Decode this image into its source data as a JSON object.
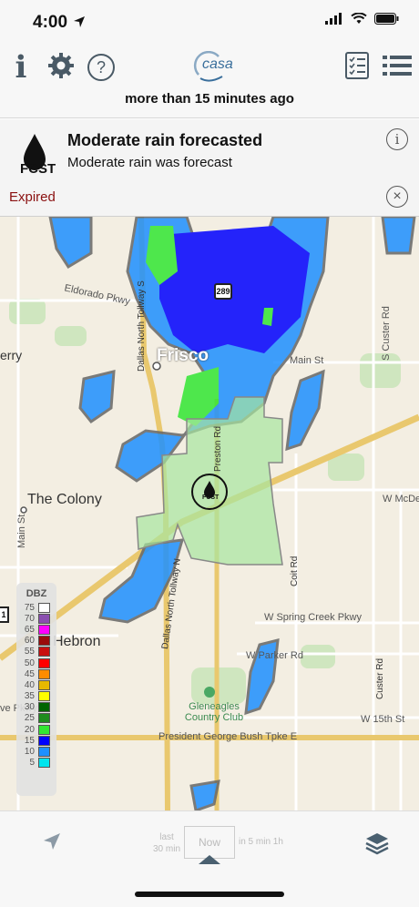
{
  "status_bar": {
    "time": "4:00"
  },
  "nav": {
    "logo_text": "casa",
    "info_glyph": "i",
    "help_glyph": "?"
  },
  "last_updated": "more than 15 minutes ago",
  "alert": {
    "badge": "FCST",
    "title": "Moderate rain forecasted",
    "body": "Moderate rain was forecast",
    "status": "Expired"
  },
  "map": {
    "cities": {
      "frisco": "Frisco",
      "the_colony": "The Colony",
      "hebron": "Hebron",
      "erry": "erry"
    },
    "roads": {
      "eldorado": "Eldorado Pkwy",
      "main_st": "Main St",
      "s_custer": "S Custer Rd",
      "w_mcdermott": "W McDe",
      "w_spring_creek": "W Spring Creek Pkwy",
      "w_parker": "W Parker Rd",
      "w_15th": "W 15th St",
      "pgbt": "President George Bush Tpke E",
      "ve_pkwy": "ve Pkwy",
      "main_st_left": "Main St",
      "dnt_top": "Dallas North Tollway S",
      "dnt_bottom": "Dallas North Tollway N",
      "preston": "Preston Rd",
      "coit": "Coit Rd",
      "custer": "Custer Rd"
    },
    "poi": {
      "gleneagles": "Gleneagles Country Club"
    },
    "shields": {
      "tx289": "289",
      "tx121": "1"
    },
    "marker_label": "FCST"
  },
  "legend": {
    "title": "DBZ",
    "entries": [
      {
        "label": "75",
        "color": "#ffffff"
      },
      {
        "label": "70",
        "color": "#8a4fb0"
      },
      {
        "label": "65",
        "color": "#ff00ff"
      },
      {
        "label": "60",
        "color": "#9a0b0b"
      },
      {
        "label": "55",
        "color": "#c80f0f"
      },
      {
        "label": "50",
        "color": "#ff0000"
      },
      {
        "label": "45",
        "color": "#ff8c00"
      },
      {
        "label": "40",
        "color": "#e6b800"
      },
      {
        "label": "35",
        "color": "#ffff00"
      },
      {
        "label": "30",
        "color": "#006400"
      },
      {
        "label": "25",
        "color": "#1e8c1e"
      },
      {
        "label": "20",
        "color": "#32e632"
      },
      {
        "label": "15",
        "color": "#0000ff"
      },
      {
        "label": "10",
        "color": "#1e90ff"
      },
      {
        "label": "5",
        "color": "#00e5ee"
      }
    ]
  },
  "timeline": {
    "past": [
      "last",
      "30 min"
    ],
    "now": "Now",
    "future": "in 5 min 1h"
  },
  "colors": {
    "accent": "#4a5a66",
    "expired": "#8a1010",
    "forecast_area": "#a6e6a0"
  }
}
